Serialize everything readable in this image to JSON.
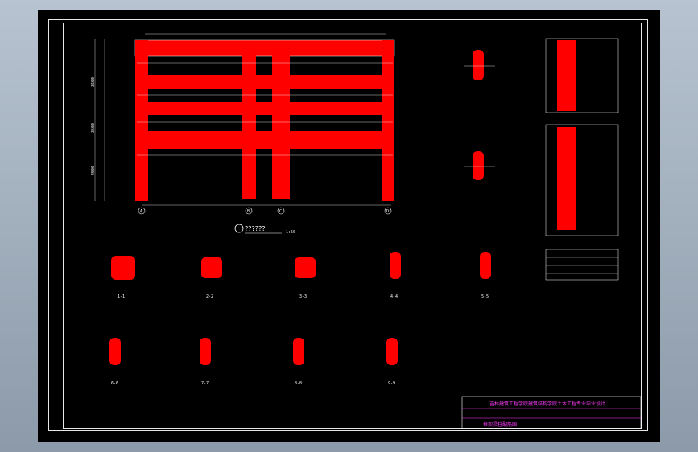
{
  "drawing": {
    "main_view_label": "??????",
    "main_view_scale": "1:50",
    "axis_labels": [
      "A",
      "B",
      "C",
      "D"
    ],
    "title_block_school": "吉林建筑工程学院建筑结构学院土木工程专业毕业设计",
    "title_block_drawing_name": "框架梁柱配筋图",
    "section_labels": [
      "1-1",
      "2-2",
      "3-3",
      "4-4",
      "5-5",
      "6-6",
      "7-7",
      "8-8",
      "9-9"
    ]
  },
  "colors": {
    "background": "#000000",
    "beam_fill": "#ff0000",
    "line": "#ffffff",
    "title_block": "#ff3cff"
  }
}
